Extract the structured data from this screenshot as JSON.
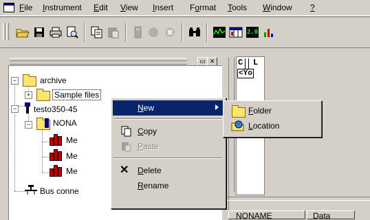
{
  "menubar": {
    "items": [
      "File",
      "Instrument",
      "Edit",
      "View",
      "Insert",
      "Format",
      "Tools",
      "Window",
      "?"
    ]
  },
  "toolbar": {
    "icons": [
      "open-folder-icon",
      "save-icon",
      "print-icon",
      "print-preview-icon",
      "copy-icon",
      "paste-icon",
      "device-icon",
      "record-icon",
      "stop-icon",
      "find-icon",
      "graph-icon",
      "table-icon",
      "digital-display-icon",
      "bar-chart-icon"
    ],
    "display_label": "2.0"
  },
  "tree": {
    "nodes": [
      {
        "label": "archive",
        "icon": "folder-icon"
      },
      {
        "label": "Sample files",
        "icon": "folder-icon",
        "selected": true
      },
      {
        "label": "testo350-45",
        "icon": "instrument-icon"
      },
      {
        "label": "NONA",
        "icon": "folder-icon"
      },
      {
        "label": "Me",
        "icon": "measurement-icon"
      },
      {
        "label": "Me",
        "icon": "measurement-icon"
      },
      {
        "label": "Me",
        "icon": "measurement-icon"
      },
      {
        "label": "Bus conne",
        "icon": "bus-icon"
      }
    ]
  },
  "right_pane": {
    "cell_c": "C",
    "cell_l": "L",
    "cell_yo": "<Yo",
    "col1": "NONAME",
    "col2": "Data"
  },
  "context_menu": {
    "items": [
      {
        "label": "New",
        "accel": "N"
      },
      {
        "label": "Copy",
        "accel": "C"
      },
      {
        "label": "Paste",
        "accel": "P",
        "disabled": true
      },
      {
        "label": "Delete",
        "accel": "D"
      },
      {
        "label": "Rename",
        "accel": "R"
      }
    ]
  },
  "submenu": {
    "items": [
      {
        "label": "Folder",
        "accel": "F"
      },
      {
        "label": "Location",
        "accel": "L"
      }
    ]
  },
  "colors": {
    "highlight": "#0a246a",
    "face": "#d4d0c8",
    "folder": "#fce46e"
  }
}
